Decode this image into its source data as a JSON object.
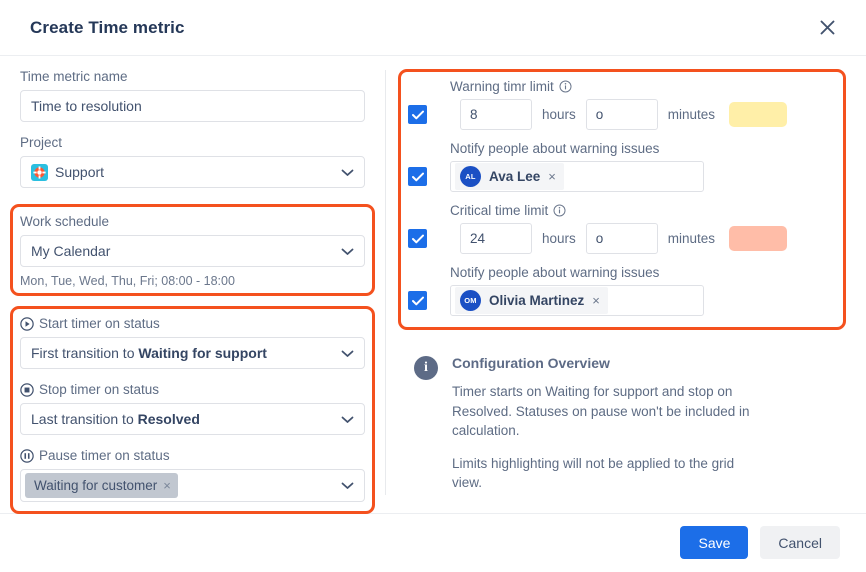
{
  "header": {
    "title": "Create Time metric",
    "close_icon": "close-icon"
  },
  "left": {
    "metric_name": {
      "label": "Time metric name",
      "value": "Time to resolution",
      "placeholder": "Time metric name"
    },
    "project": {
      "label": "Project",
      "value": "Support",
      "icon": "lifebuoy-icon",
      "icon_bg": "#2bbfe0",
      "chevron": "chevron-down-icon"
    },
    "work_schedule": {
      "label": "Work schedule",
      "value": "My Calendar",
      "helper": "Mon, Tue, Wed, Thu, Fri; 08:00 - 18:00",
      "chevron": "chevron-down-icon"
    },
    "start_timer": {
      "icon": "play-circle-icon",
      "label": "Start timer on status",
      "value_prefix": "First transition to ",
      "value_strong": "Waiting for support",
      "chevron": "chevron-down-icon"
    },
    "stop_timer": {
      "icon": "stop-circle-icon",
      "label": "Stop timer on status",
      "value_prefix": "Last transition to ",
      "value_strong": "Resolved",
      "chevron": "chevron-down-icon"
    },
    "pause_timer": {
      "icon": "pause-circle-icon",
      "label": "Pause timer on status",
      "chip": "Waiting for customer",
      "chip_remove": "×",
      "chevron": "chevron-down-icon"
    }
  },
  "right": {
    "warning_limit": {
      "label": "Warning timr limit",
      "info_icon": "info-circle-icon",
      "checked": true,
      "hours": "8",
      "hours_unit": "hours",
      "minutes": "o",
      "minutes_unit": "minutes",
      "swatch_color": "#ffefa8"
    },
    "warning_notify": {
      "label": "Notify people about warning issues",
      "checked": true,
      "person": "Ava Lee",
      "person_initials": "AL",
      "avatar_color": "#1b50c4",
      "remove": "×"
    },
    "critical_limit": {
      "label": "Critical time limit",
      "info_icon": "info-circle-icon",
      "checked": true,
      "hours": "24",
      "hours_unit": "hours",
      "minutes": "o",
      "minutes_unit": "minutes",
      "swatch_color": "#ffbda8"
    },
    "critical_notify": {
      "label": "Notify people about warning issues",
      "checked": true,
      "person": "Olivia Martinez",
      "person_initials": "OM",
      "avatar_color": "#1b50c4",
      "remove": "×"
    },
    "config_overview": {
      "icon": "info-circle-icon",
      "title": "Configuration Overview",
      "paragraph1": "Timer starts on Waiting for support and stop on Resolved. Statuses on pause won't be included in calculation.",
      "paragraph2": "Limits highlighting will not be applied to the grid view."
    }
  },
  "footer": {
    "save_label": "Save",
    "cancel_label": "Cancel"
  },
  "annotations": {
    "color": "#f4511e",
    "boxes": [
      "work-schedule-highlight",
      "timer-status-highlight",
      "limits-highlight"
    ]
  }
}
